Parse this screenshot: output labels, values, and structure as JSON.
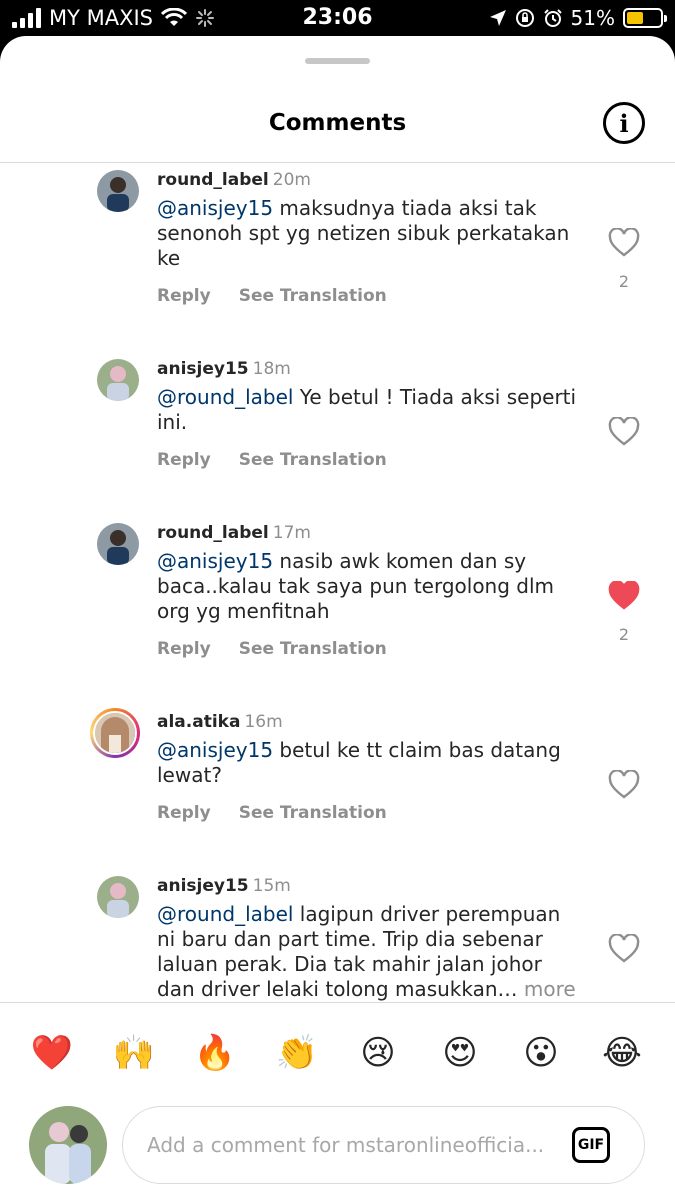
{
  "status_bar": {
    "carrier": "MY MAXIS",
    "time": "23:06",
    "battery": "51%",
    "battery_level": 0.51
  },
  "header": {
    "title": "Comments",
    "info_icon": "info-icon"
  },
  "comments": [
    {
      "username": "round_label",
      "time": "20m",
      "mention": "@anisjey15",
      "text": " maksudnya tiada aksi tak senonoh spt yg netizen sibuk perkatakan ke",
      "liked": false,
      "likes": "2",
      "reply_label": "Reply",
      "translate_label": "See Translation"
    },
    {
      "username": "anisjey15",
      "time": "18m",
      "mention": "@round_label",
      "text": " Ye betul ! Tiada aksi seperti ini.",
      "liked": false,
      "likes": "",
      "reply_label": "Reply",
      "translate_label": "See Translation"
    },
    {
      "username": "round_label",
      "time": "17m",
      "mention": "@anisjey15",
      "text": " nasib awk komen dan sy baca..kalau tak saya pun tergolong dlm org yg menfitnah",
      "liked": true,
      "likes": "2",
      "reply_label": "Reply",
      "translate_label": "See Translation"
    },
    {
      "username": "ala.atika",
      "time": "16m",
      "mention": "@anisjey15",
      "text": " betul ke tt claim bas datang lewat?",
      "liked": false,
      "likes": "",
      "reply_label": "Reply",
      "translate_label": "See Translation"
    },
    {
      "username": "anisjey15",
      "time": "15m",
      "mention": "@round_label",
      "text": " lagipun driver perempuan ni baru dan part time. Trip dia sebenar laluan perak. Dia tak mahir jalan johor dan driver lelaki tolong masukkan…",
      "more": " more",
      "liked": false,
      "likes": ""
    }
  ],
  "emoji_bar": [
    "❤️",
    "🙌",
    "🔥",
    "👏",
    "😢",
    "😍",
    "😮",
    "😂"
  ],
  "composer": {
    "placeholder": "Add a comment for mstaronlineofficia...",
    "gif_label": "GIF"
  },
  "colors": {
    "mention": "#00376b",
    "like_red": "#ed4956",
    "muted": "#8e8e8e"
  }
}
